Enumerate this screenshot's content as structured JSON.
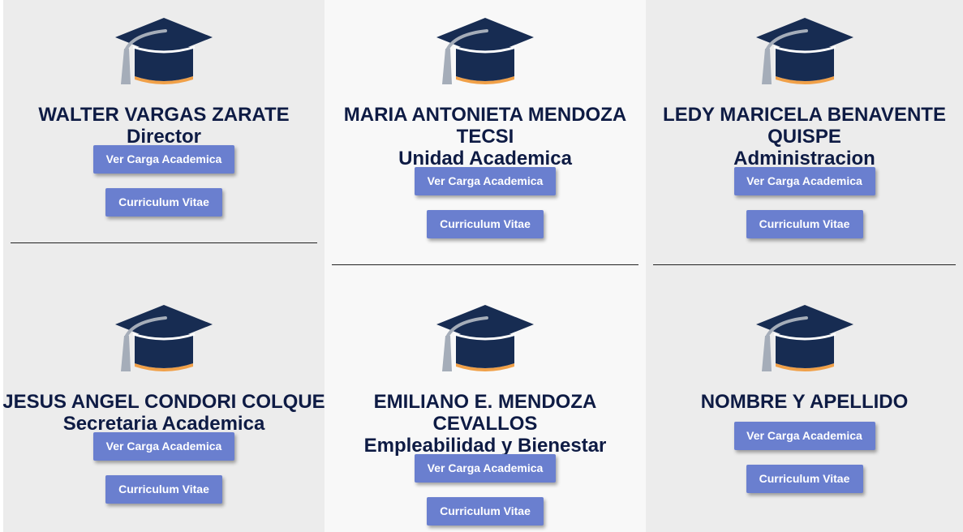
{
  "cards": [
    {
      "name": "WALTER VARGAS ZARATE",
      "role": "Director",
      "carga_label": "Ver Carga Academica",
      "cv_label": "Curriculum Vitae"
    },
    {
      "name_line1": "MARIA ANTONIETA MENDOZA",
      "name_line2": "TECSI",
      "role": "Unidad Academica",
      "carga_label": "Ver Carga Academica",
      "cv_label": "Curriculum Vitae"
    },
    {
      "name_line1": "LEDY MARICELA BENAVENTE",
      "name_line2": "QUISPE",
      "role": "Administracion",
      "carga_label": "Ver Carga Academica",
      "cv_label": "Curriculum Vitae"
    },
    {
      "name": "JESUS ANGEL CONDORI COLQUE",
      "role": "Secretaria Academica",
      "carga_label": "Ver Carga Academica",
      "cv_label": "Curriculum Vitae"
    },
    {
      "name_line1": "EMILIANO E. MENDOZA",
      "name_line2": "CEVALLOS",
      "role": "Empleabilidad y Bienestar",
      "carga_label": "Ver Carga Academica",
      "cv_label": "Curriculum Vitae"
    },
    {
      "name": "NOMBRE Y APELLIDO",
      "carga_label": "Ver Carga Academica",
      "cv_label": "Curriculum Vitae"
    }
  ],
  "colors": {
    "cap_navy": "#172c52",
    "tassel": "#a5adb9",
    "cap_accent": "#f0a048",
    "button": "#6a7fcf",
    "text": "#0e1b44"
  },
  "icons": {
    "card_icon": "graduation-cap-icon"
  }
}
